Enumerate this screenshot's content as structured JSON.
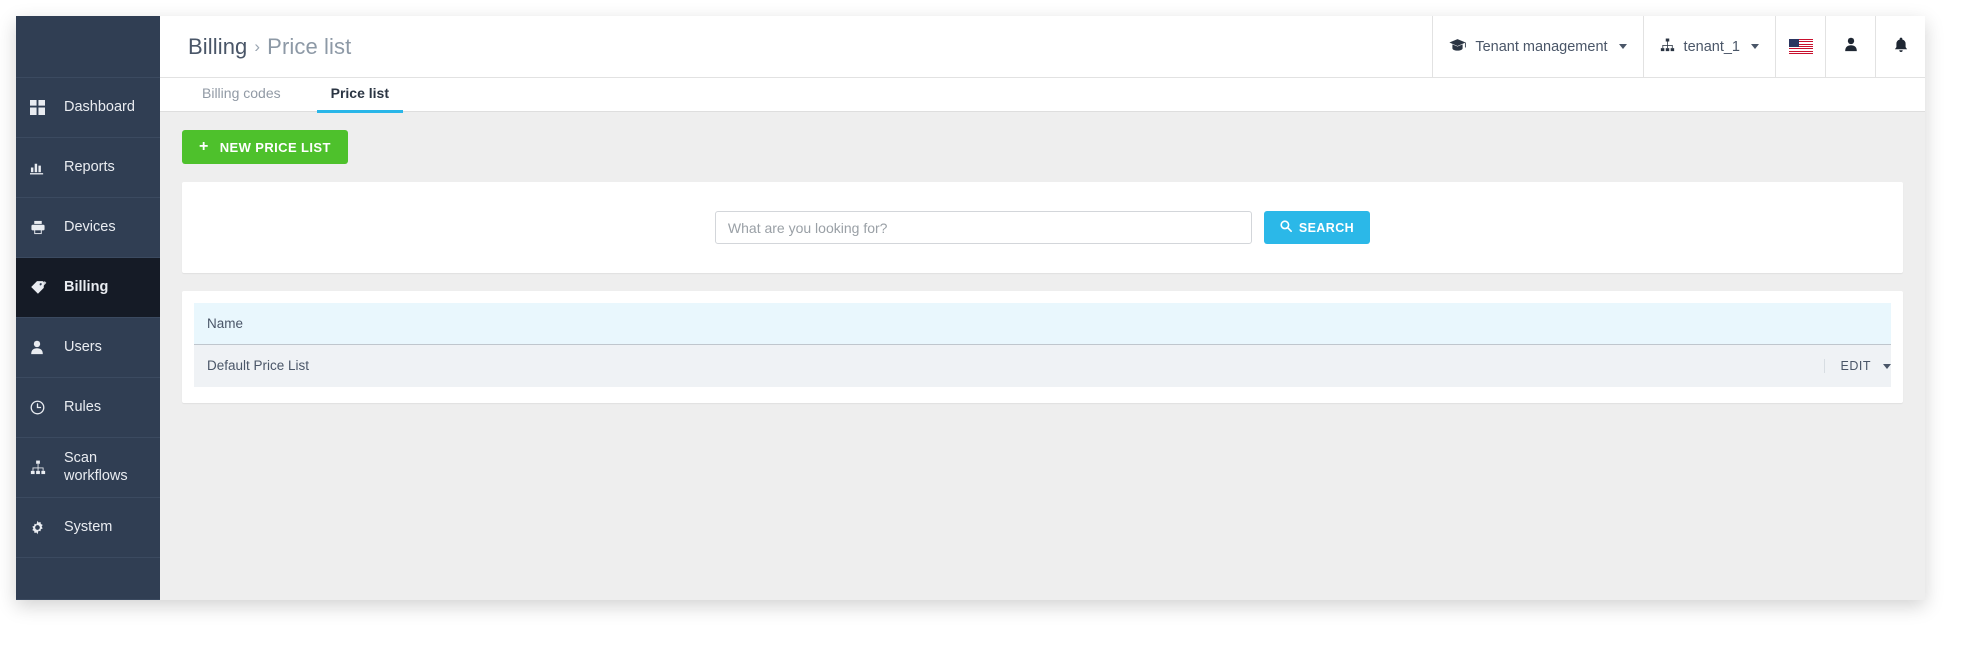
{
  "sidebar": {
    "items": [
      {
        "label": "Dashboard",
        "icon": "dashboard-grid-icon",
        "active": false
      },
      {
        "label": "Reports",
        "icon": "bar-chart-icon",
        "active": false
      },
      {
        "label": "Devices",
        "icon": "printer-icon",
        "active": false
      },
      {
        "label": "Billing",
        "icon": "tag-icon",
        "active": true
      },
      {
        "label": "Users",
        "icon": "user-icon",
        "active": false
      },
      {
        "label": "Rules",
        "icon": "clock-icon",
        "active": false
      },
      {
        "label": "Scan workflows",
        "icon": "sitemap-icon",
        "active": false
      },
      {
        "label": "System",
        "icon": "gear-icon",
        "active": false
      }
    ]
  },
  "topbar": {
    "breadcrumb": {
      "root": "Billing",
      "separator": "›",
      "current": "Price list"
    },
    "tenant_management": {
      "label": "Tenant management",
      "icon": "graduation-cap-icon"
    },
    "tenant": {
      "label": "tenant_1",
      "icon": "sitemap-icon"
    },
    "language": {
      "icon": "us-flag-icon",
      "value": "US"
    },
    "account": {
      "icon": "user-icon"
    },
    "notifications": {
      "icon": "bell-icon"
    }
  },
  "tabs": [
    {
      "label": "Billing codes",
      "active": false
    },
    {
      "label": "Price list",
      "active": true
    }
  ],
  "toolbar": {
    "new_price_list_label": "NEW PRICE LIST",
    "new_price_list_icon": "plus-icon"
  },
  "search": {
    "placeholder": "What are you looking for?",
    "value": "",
    "button_label": "SEARCH",
    "button_icon": "search-icon"
  },
  "table": {
    "columns": [
      "Name"
    ],
    "rows": [
      {
        "name": "Default Price List",
        "action_label": "EDIT",
        "action_icon": "caret-down-icon"
      }
    ]
  },
  "colors": {
    "sidebar_bg": "#303e53",
    "sidebar_active_bg": "#151b26",
    "accent_blue": "#2bb8e8",
    "success_green": "#4ec12c",
    "table_header_bg": "#e9f7fd",
    "table_row_bg": "#eff2f5",
    "page_bg": "#eeeeee"
  }
}
